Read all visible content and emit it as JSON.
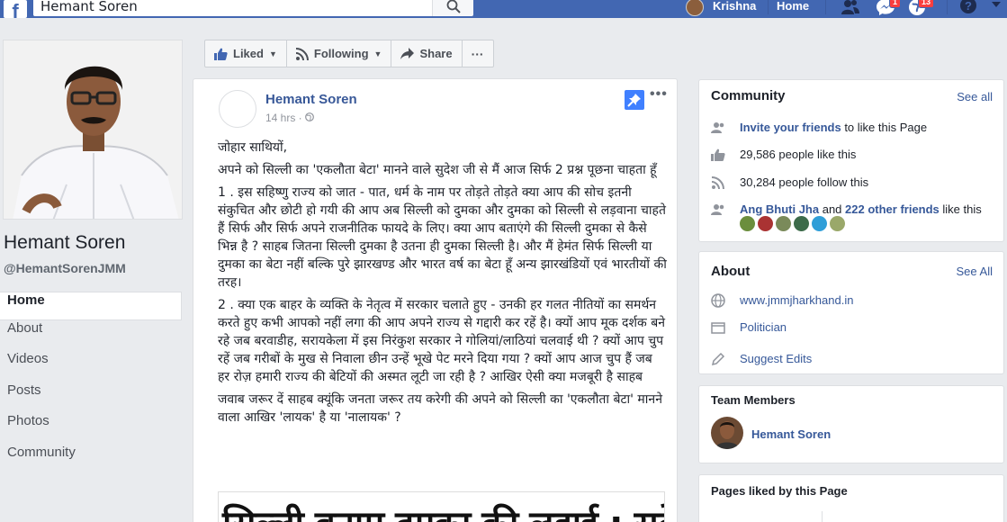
{
  "topbar": {
    "search_value": "Hemant Soren",
    "user_name": "Krishna",
    "home_label": "Home",
    "messages_badge": "1",
    "notifications_badge": "13"
  },
  "page": {
    "name": "Hemant Soren",
    "handle": "@HemantSorenJMM"
  },
  "nav": {
    "items": [
      {
        "label": "Home"
      },
      {
        "label": "About"
      },
      {
        "label": "Videos"
      },
      {
        "label": "Posts"
      },
      {
        "label": "Photos"
      },
      {
        "label": "Community"
      }
    ]
  },
  "actions": {
    "liked": "Liked",
    "following": "Following",
    "share": "Share",
    "more": "···"
  },
  "post": {
    "author": "Hemant Soren",
    "time": "14 hrs ·",
    "paragraphs": [
      "जोहार साथियों,",
      "अपने को सिल्ली का 'एकलौता बेटा' मानने वाले सुदेश जी से मैं आज सिर्फ 2 प्रश्न पूछना चाहता हूँ",
      "1 . इस सहिष्णु राज्य को जात - पात, धर्म के नाम पर तोड़ते तोड़ते क्या आप की सोच इतनी संकुचित और छोटी हो गयी की आप अब सिल्ली को दुमका और दुमका को सिल्ली से लड़वाना चाहते हैं सिर्फ और सिर्फ अपने राजनीतिक फायदे के लिए। क्या आप बताएंगे की सिल्ली दुमका से कैसे भिन्न है ? साहब जितना सिल्ली दुमका है उतना ही दुमका सिल्ली है। और मैं हेमंत सिर्फ सिल्ली या दुमका का बेटा नहीं बल्कि पुरे झारखण्ड और भारत वर्ष का बेटा हूँ अन्य झारखंडियों एवं भारतीयों की तरह।",
      "2 . क्या एक बाहर के व्यक्ति के नेतृत्व में सरकार चलाते हुए - उनकी हर गलत नीतियों का समर्थन करते हुए कभी आपको नहीं लगा की आप अपने राज्य से गद्दारी कर रहें है। क्यों आप मूक दर्शक बने रहे जब बरवाडीह, सरायकेला में इस निरंकुश सरकार ने गोलियां/लाठियां चलवाई थी ? क्यों आप चुप रहें जब गरीबों के मुख से निवाला छीन उन्हें भूखे पेट मरने दिया गया ? क्यों आप आज चुप हैं जब हर रोज़ हमारी राज्य की बेटियों की अस्मत लूटी जा रही है ? आखिर ऐसी क्या मजबूरी है साहब",
      "जवाब जरूर दें साहब क्यूंकि जनता जरूर तय करेगी की अपने को सिल्ली का 'एकलौता बेटा' मानने वाला आखिर 'लायक' है या 'नालायक' ?"
    ],
    "image_text": "सिल्ली बनाम दुमका की लड़ाई : सुदेश"
  },
  "community": {
    "title": "Community",
    "see_all": "See all",
    "invite_link": "Invite your friends",
    "invite_rest": " to like this Page",
    "likes": "29,586 people like this",
    "follows": "30,284 people follow this",
    "friend_name": "Ang Bhuti Jha",
    "friend_mid": " and ",
    "friend_others": "222 other friends",
    "friend_rest": " like this"
  },
  "about": {
    "title": "About",
    "see_all": "See All",
    "website": "www.jmmjharkhand.in",
    "category": "Politician",
    "suggest": "Suggest Edits"
  },
  "team": {
    "title": "Team Members",
    "member": "Hemant Soren"
  },
  "pages_liked": {
    "title": "Pages liked by this Page"
  },
  "colors": {
    "brand": "#4267b2",
    "link": "#365899",
    "badge": "#fa3e3e"
  }
}
